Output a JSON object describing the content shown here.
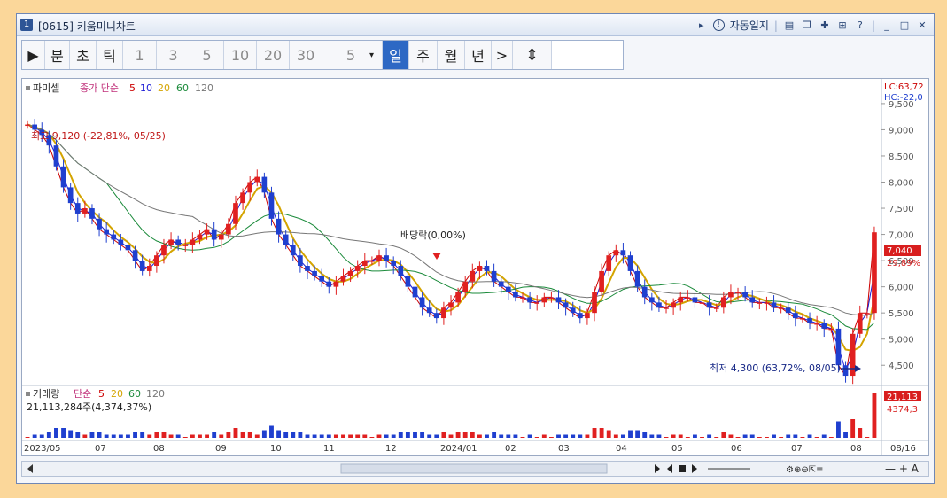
{
  "window": {
    "number": "1",
    "title": "[0615] 키움미니차트",
    "auto_log": "자동일지"
  },
  "toolbar": {
    "play": "▶",
    "period_buttons": [
      "분",
      "초",
      "틱"
    ],
    "numbers": [
      "1",
      "3",
      "5",
      "10",
      "20",
      "30"
    ],
    "value": "5",
    "dropdown": "▾",
    "day": "일",
    "week": "주",
    "month": "월",
    "year": "년",
    "next": ">"
  },
  "price_panel": {
    "legend_title": "파미셀",
    "legend_ma": "종가 단순",
    "ma_periods": [
      "5",
      "10",
      "20",
      "60",
      "120"
    ],
    "ma_colors": [
      "#cc0000",
      "#1b1bd6",
      "#d4a400",
      "#1a8a3a",
      "#777777"
    ],
    "lc_label": "LC:63,72",
    "hc_label": "HC:-22,0",
    "high_note": "최고 9,120 (-22,81%, 05/25)",
    "dividend_note": "배당락(0,00%)",
    "low_note": "최저 4,300 (63,72%, 08/05)",
    "y_ticks": [
      "9,500",
      "9,000",
      "8,500",
      "8,000",
      "7,500",
      "7,000",
      "6,500",
      "6,000",
      "5,500",
      "5,000",
      "4,500"
    ],
    "current_price": "7,040",
    "current_change": "29,89%"
  },
  "volume_panel": {
    "legend_title": "거래량",
    "legend_ma": "단순",
    "ma_periods": [
      "5",
      "20",
      "60",
      "120"
    ],
    "volume_text": "21,113,284주(4,374,37%)",
    "right_value1": "21,113",
    "right_value2": "4374,3"
  },
  "x_axis": [
    "2023/05",
    "07",
    "08",
    "09",
    "10",
    "11",
    "12",
    "2024/01",
    "02",
    "03",
    "04",
    "05",
    "06",
    "07",
    "08",
    "08/16"
  ],
  "colors": {
    "up": "#e02020",
    "down": "#1f3fcf",
    "accent": "#2d68c4"
  },
  "chart_data": {
    "type": "candlestick",
    "y_range": [
      4300,
      9500
    ],
    "series_close_approx": [
      9100,
      9000,
      8900,
      8700,
      8300,
      7900,
      7600,
      7400,
      7500,
      7300,
      7100,
      7000,
      6900,
      6800,
      6700,
      6500,
      6300,
      6400,
      6600,
      6800,
      6900,
      6800,
      6800,
      6900,
      7000,
      7100,
      6900,
      7000,
      7200,
      7600,
      7800,
      8000,
      8100,
      7800,
      7300,
      7000,
      6800,
      6600,
      6400,
      6300,
      6200,
      6100,
      6000,
      6100,
      6200,
      6300,
      6400,
      6500,
      6500,
      6600,
      6500,
      6400,
      6200,
      6000,
      5800,
      5600,
      5500,
      5400,
      5600,
      5700,
      5900,
      6100,
      6300,
      6400,
      6300,
      6100,
      6000,
      5900,
      5800,
      5800,
      5700,
      5700,
      5800,
      5800,
      5700,
      5600,
      5500,
      5400,
      5500,
      5900,
      6300,
      6600,
      6700,
      6600,
      6300,
      6000,
      5800,
      5700,
      5600,
      5600,
      5700,
      5800,
      5800,
      5700,
      5700,
      5600,
      5600,
      5800,
      5900,
      5900,
      5800,
      5700,
      5700,
      5700,
      5600,
      5600,
      5500,
      5400,
      5400,
      5300,
      5300,
      5200,
      5200,
      4500,
      4300,
      5100,
      5500,
      5500,
      7040
    ],
    "annotations": [
      {
        "text": "최고 9,120 (-22,81%, 05/25)",
        "value": 9120
      },
      {
        "text": "배당락(0,00%)"
      },
      {
        "text": "최저 4,300 (63,72%, 08/05)",
        "value": 4300
      }
    ]
  }
}
